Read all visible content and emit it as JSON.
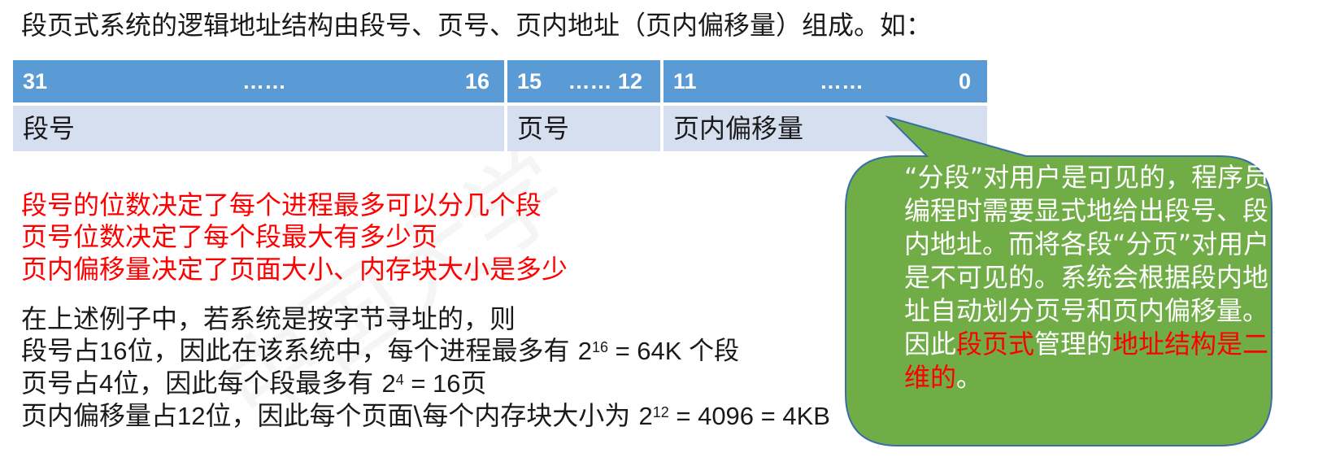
{
  "intro": "段页式系统的逻辑地址结构由段号、页号、页内地址（页内偏移量）组成。如：",
  "table": {
    "bits": {
      "seg_hi": "31",
      "seg_dots": "……",
      "seg_lo": "16",
      "page_hi": "15",
      "page_dots_lo": "…… 12",
      "off_hi": "11",
      "off_dots": "……",
      "off_lo": "0"
    },
    "names": {
      "segment": "段号",
      "page": "页号",
      "offset": "页内偏移量"
    }
  },
  "rules": [
    "段号的位数决定了每个进程最多可以分几个段",
    "页号位数决定了每个段最大有多少页",
    "页内偏移量决定了页面大小、内存块大小是多少"
  ],
  "example": {
    "lead": "在上述例子中，若系统是按字节寻址的，则",
    "line1": {
      "a": "段号占",
      "n1": "16",
      "b": "位，因此在该系统中，每个进程最多有 ",
      "base": "2",
      "exp": "16",
      "c": " = 64K 个段"
    },
    "line2": {
      "a": "页号占",
      "n1": "4",
      "b": "位，因此每个段最多有 ",
      "base": "2",
      "exp": "4",
      "c": " = 16",
      "d": "页"
    },
    "line3": {
      "a": "页内偏移量占",
      "n1": "12",
      "b": "位，因此每个页面\\每个内存块大小为 ",
      "base": "2",
      "exp": "12",
      "c": " = 4096 = 4KB"
    }
  },
  "callout": {
    "p1": "“分段”对用户是可见的，程序员编程时需要显式地给出段号、段内地址。而将各段“分页”对用户是不可见的。系统会根据段内地址自动划分页号和页内偏移量。",
    "p2_a": "因此",
    "p2_b": "段页式",
    "p2_c": "管理的",
    "p2_d": "地址结构是二维的",
    "p2_e": "。"
  },
  "colors": {
    "header_blue": "#5b9bd5",
    "row_light": "#d6dff0",
    "callout_green": "#70ad47",
    "callout_border": "#3a6ea5",
    "red": "#ff0000"
  }
}
